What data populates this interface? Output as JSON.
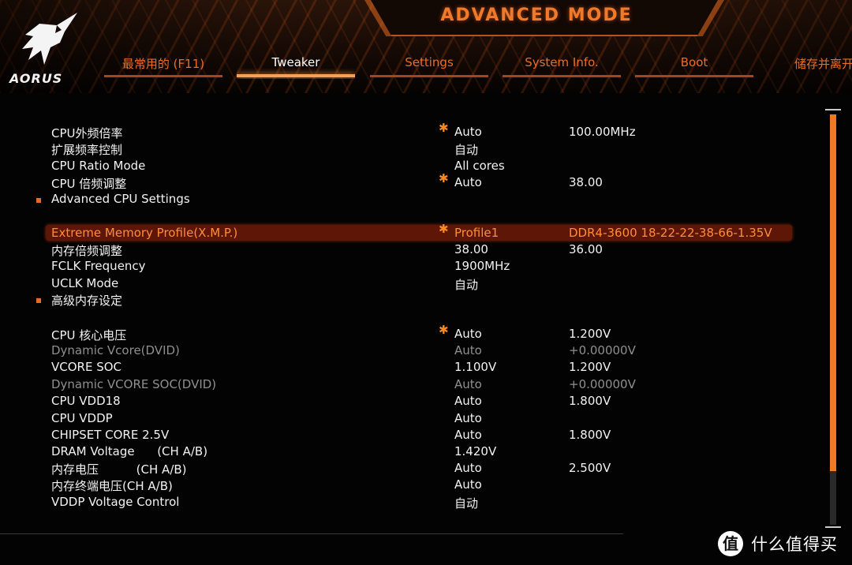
{
  "header": {
    "title": "ADVANCED MODE",
    "logo_text": "AORUS",
    "tabs": [
      {
        "label": "最常用的 (F11)",
        "active": false
      },
      {
        "label": "Tweaker",
        "active": true
      },
      {
        "label": "Settings",
        "active": false
      },
      {
        "label": "System Info.",
        "active": false
      },
      {
        "label": "Boot",
        "active": false
      },
      {
        "label": "储存并离开",
        "active": false
      }
    ]
  },
  "settings": [
    {
      "label": "CPU外频倍率",
      "star": true,
      "value": "Auto",
      "value2": "100.00MHz"
    },
    {
      "label": "扩展频率控制",
      "value": "自动"
    },
    {
      "label": "CPU Ratio Mode",
      "value": "All cores"
    },
    {
      "label": "CPU 倍频调整",
      "star": true,
      "value": "Auto",
      "value2": "38.00"
    },
    {
      "label": "Advanced CPU Settings",
      "submenu": true
    },
    {
      "label": "Extreme Memory Profile(X.M.P.)",
      "star": true,
      "value": "Profile1",
      "value2": "DDR4-3600 18-22-22-38-66-1.35V",
      "selected": true
    },
    {
      "label": "内存倍频调整",
      "value": "38.00",
      "value2": "36.00"
    },
    {
      "label": "FCLK Frequency",
      "value": "1900MHz"
    },
    {
      "label": "UCLK Mode",
      "value": "自动"
    },
    {
      "label": "高级内存设定",
      "submenu": true
    },
    {
      "label": "CPU 核心电压",
      "star": true,
      "value": "Auto",
      "value2": "1.200V"
    },
    {
      "label": "Dynamic Vcore(DVID)",
      "value": "Auto",
      "value2": "+0.00000V",
      "dim": true
    },
    {
      "label": "VCORE SOC",
      "value": "1.100V",
      "value2": "1.200V"
    },
    {
      "label": "Dynamic VCORE SOC(DVID)",
      "value": "Auto",
      "value2": "+0.00000V",
      "dim": true
    },
    {
      "label": "CPU VDD18",
      "value": "Auto",
      "value2": "1.800V"
    },
    {
      "label": "CPU VDDP",
      "value": "Auto"
    },
    {
      "label": "CHIPSET CORE 2.5V",
      "value": "Auto",
      "value2": "1.800V"
    },
    {
      "label": "DRAM Voltage      (CH A/B)",
      "value": "1.420V"
    },
    {
      "label": "内存电压          (CH A/B)",
      "value": "Auto",
      "value2": "2.500V"
    },
    {
      "label": "内存终端电压(CH A/B)",
      "value": "Auto"
    },
    {
      "label": "VDDP Voltage Control",
      "value": "自动"
    }
  ],
  "scrollbar": {
    "thumb_fraction": 0.87
  },
  "watermark": {
    "badge": "值",
    "text": "什么值得买"
  },
  "colors": {
    "accent": "#f07a24",
    "selected_row": "#5e1707",
    "dim_text": "#8f8f8f"
  }
}
